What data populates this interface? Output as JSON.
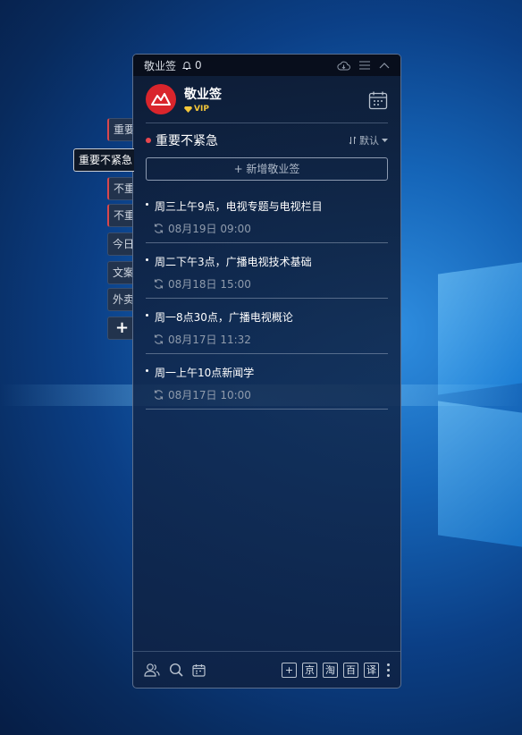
{
  "titlebar": {
    "app_name": "敬业签",
    "notification_count": "0"
  },
  "user": {
    "name": "敬业签",
    "badge": "VIP"
  },
  "side_tabs": [
    {
      "label": "重要",
      "active": false
    },
    {
      "label": "重要不紧急",
      "active": true
    },
    {
      "label": "不重",
      "active": false
    },
    {
      "label": "不重",
      "active": false
    },
    {
      "label": "今日",
      "active": false
    },
    {
      "label": "文案",
      "active": false
    },
    {
      "label": "外卖",
      "active": false
    },
    {
      "label": "+",
      "active": false
    }
  ],
  "category": {
    "name": "重要不紧急",
    "sort_label": "默认",
    "add_button": "+ 新增敬业签"
  },
  "notes": [
    {
      "title": "周三上午9点，电视专题与电视栏目",
      "date": "08月19日 09:00"
    },
    {
      "title": "周二下午3点，广播电视技术基础",
      "date": "08月18日 15:00"
    },
    {
      "title": "周一8点30点，广播电视概论",
      "date": "08月17日 11:32"
    },
    {
      "title": "周一上午10点新闻学",
      "date": "08月17日 10:00"
    }
  ],
  "footer": {
    "shortcuts": [
      "+",
      "京",
      "淘",
      "百",
      "译"
    ]
  },
  "colors": {
    "accent_red": "#d9252c",
    "category_dot": "#e8474e",
    "vip_gold": "#f3c63a"
  }
}
